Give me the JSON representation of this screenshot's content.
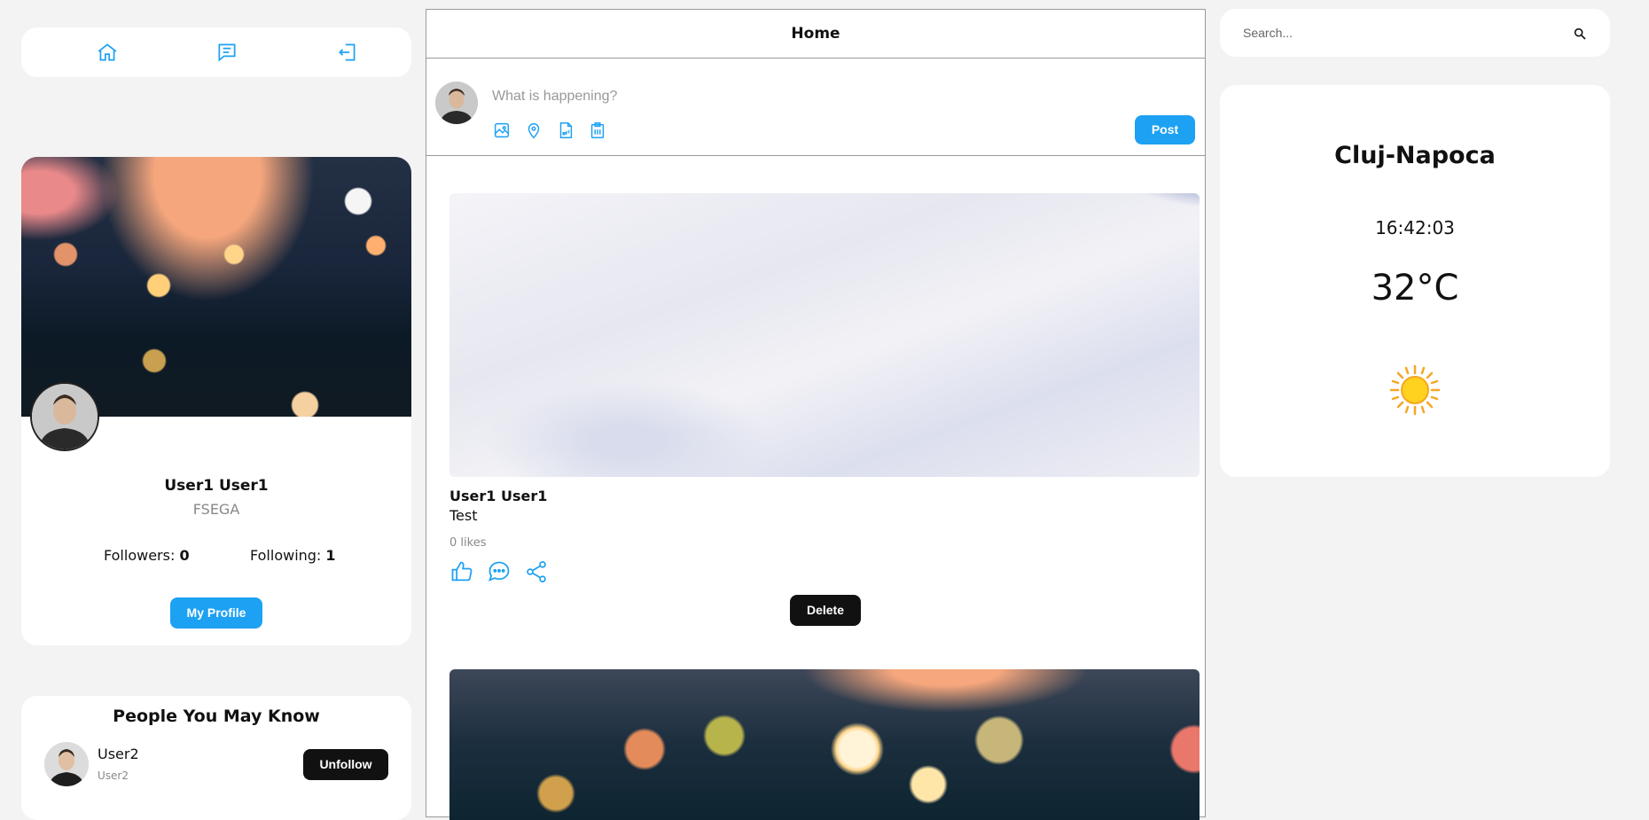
{
  "nav": {
    "icons": [
      "home-icon",
      "messages-icon",
      "logout-icon"
    ]
  },
  "profile": {
    "name": "User1 User1",
    "organization": "FSEGA",
    "followers_label": "Followers:",
    "followers_count": "0",
    "following_label": "Following:",
    "following_count": "1",
    "button_label": "My Profile"
  },
  "people_you_may_know": {
    "title": "People You May Know",
    "people": [
      {
        "name": "User2",
        "username": "User2",
        "action_label": "Unfollow"
      }
    ]
  },
  "feed": {
    "title": "Home",
    "composer": {
      "placeholder": "What is happening?",
      "post_label": "Post",
      "tool_icons": [
        "image-icon",
        "location-icon",
        "gif-icon",
        "clipboard-icon"
      ]
    },
    "posts": [
      {
        "author": "User1 User1",
        "text": "Test",
        "likes": "0 likes",
        "delete_label": "Delete",
        "action_icons": [
          "like-icon",
          "comment-icon",
          "share-icon"
        ]
      }
    ]
  },
  "search": {
    "placeholder": "Search..."
  },
  "weather": {
    "city": "Cluj-Napoca",
    "time": "16:42:03",
    "temperature": "32°C",
    "condition_icon": "sun-icon"
  },
  "colors": {
    "accent": "#1da1f2",
    "dark_button": "#111111",
    "background": "#f3f3f3"
  }
}
